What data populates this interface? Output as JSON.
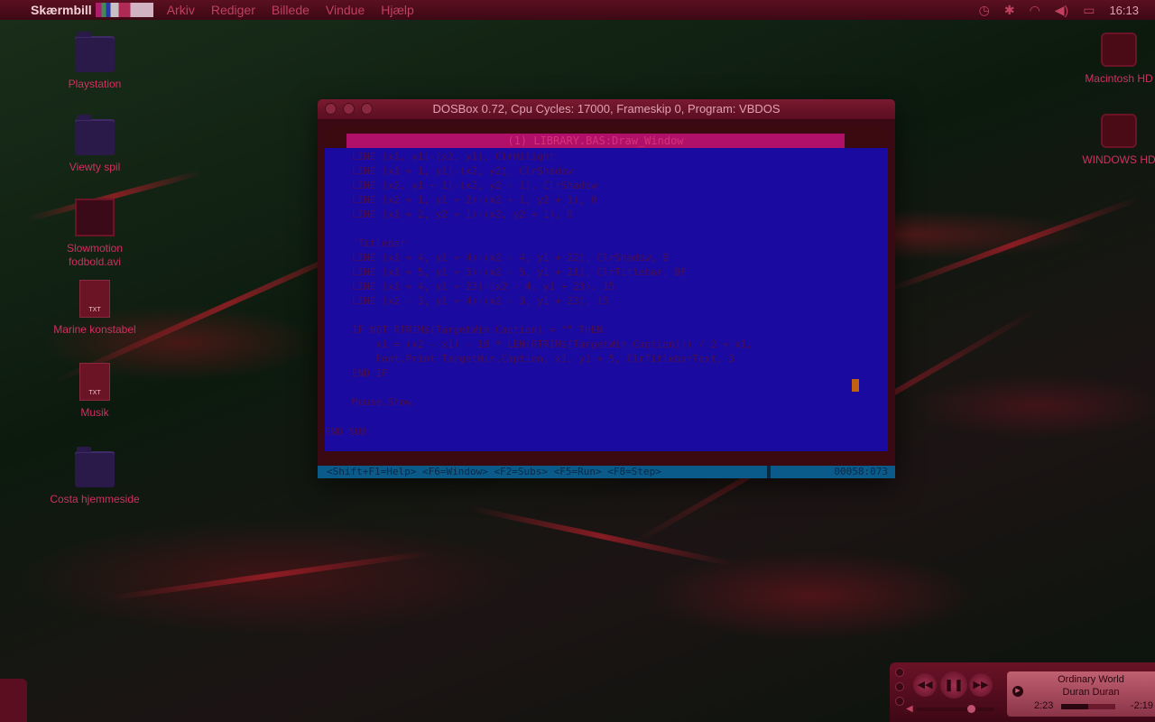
{
  "menubar": {
    "app_name": "Skærmbill",
    "items": [
      "Arkiv",
      "Rediger",
      "Billede",
      "Vindue",
      "Hjælp"
    ],
    "clock": "16:13"
  },
  "desktop": {
    "icons_left": [
      {
        "label": "Playstation",
        "kind": "folder-icon"
      },
      {
        "label": "Viewty spil",
        "kind": "folder-icon"
      },
      {
        "label": "Slowmotion fodbold.avi",
        "kind": "video-file-icon"
      },
      {
        "label": "Marine konstabel",
        "kind": "text-file-icon",
        "badge": "TXT"
      },
      {
        "label": "Musik",
        "kind": "text-file-icon",
        "badge": "TXT"
      },
      {
        "label": "Costa hjemmeside",
        "kind": "folder-icon"
      }
    ],
    "icons_right": [
      {
        "label": "Macintosh HD",
        "kind": "hard-disk-icon"
      },
      {
        "label": "WINDOWS HD",
        "kind": "hard-disk-icon"
      }
    ]
  },
  "dosbox": {
    "title": "DOSBox 0.72, Cpu Cycles:     17000, Frameskip  0, Program:    VBDOS",
    "editor_title": "(1) LIBRARY.BAS:Draw_Window",
    "code_lines": [
      "LINE (x1, y1)-(x2, y1), ClrHilight",
      "LINE (x1 + 1, y1)-(x2, y2), ClrShadow",
      "LINE (x2, y1 + 1)-(x2, y2 - 1), ClrShadow",
      "LINE (x2 + 1, y1 + 2)-(x2 + 1, y2 + 1), 0",
      "LINE (x1 + 2, y2 + 1)-(x2, y2 + 1), 0",
      "",
      "'Titlebar",
      "LINE (x1 + 4, y1 + 4)-(x2 - 4, y1 + 22), ClrShadow, B",
      "LINE (x1 + 5, y1 + 5)-(x2 - 5, y1 + 21), ClrTitlebar, BF",
      "LINE (x1 + 4, y1 + 23)-(x2 - 4, y1 + 23), 15",
      "LINE (x2 - 3, y1 + 4)-(x2 - 3, y1 + 23), 15",
      "",
      "IF NOT RTRIM$(TargetWin.Caption) = \"\" THEN",
      "    x1 = (x2 - x1) - 10 * LEN(RTRIM$(TargetWin.Caption))) / 2 + x1,",
      "    Font.Print TargetWin.Caption, x1, y1 + 5, ClrTitlebarText, 3",
      "END IF",
      "",
      "Mouse.Show"
    ],
    "end_line": "END SUB",
    "status_keys": "<Shift+F1=Help> <F6=Window> <F2=Subs> <F5=Run> <F8=Step>",
    "status_position": "00058:073"
  },
  "itunes": {
    "song": "Ordinary World",
    "artist": "Duran Duran",
    "elapsed": "2:23",
    "remaining": "-2:19",
    "progress": 0.5,
    "volume": 0.7
  },
  "colors": {
    "editor_bg": "#1a0aa0",
    "menubar_bg": "#4a0c18",
    "accent": "#b0106a"
  }
}
